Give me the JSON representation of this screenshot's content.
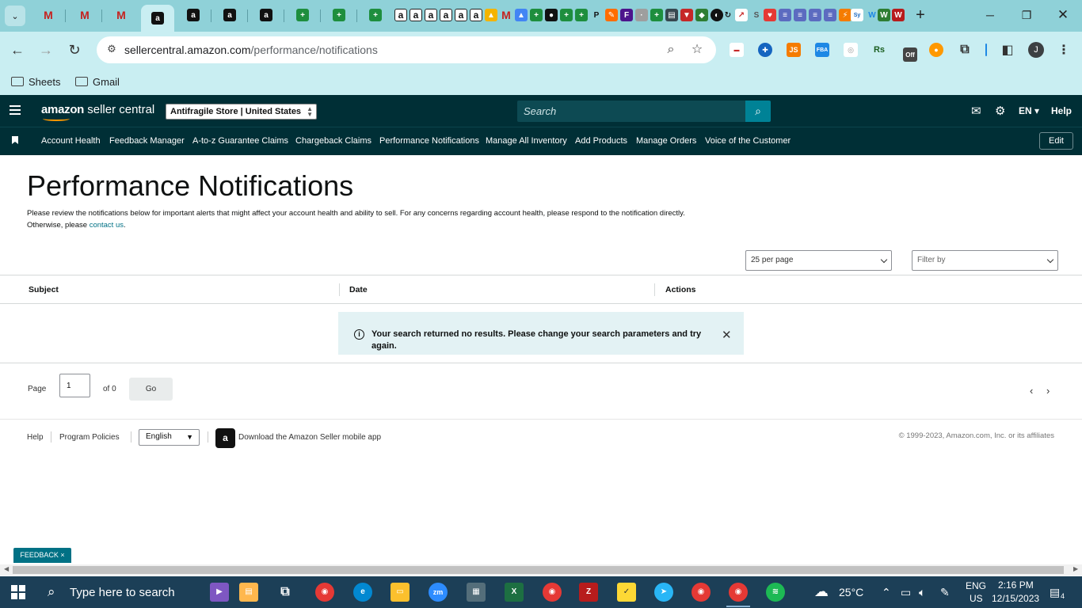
{
  "browser": {
    "url_domain": "sellercentral.amazon.com",
    "url_path": "/performance/notifications",
    "bookmarks": [
      "Sheets",
      "Gmail"
    ],
    "profile_initial": "J",
    "ext_labels": {
      "js": "JS",
      "fba": "FBA",
      "rs": "Rs",
      "off": "Off"
    }
  },
  "header": {
    "logo_bold": "amazon",
    "logo_rest": " seller central",
    "store": "Antifragile Store | United States",
    "search_placeholder": "Search",
    "language": "EN ▾",
    "help": "Help"
  },
  "nav": {
    "items": [
      "Account Health",
      "Feedback Manager",
      "A-to-z Guarantee Claims",
      "Chargeback Claims",
      "Performance Notifications",
      "Manage All Inventory",
      "Add Products",
      "Manage Orders",
      "Voice of the Customer"
    ],
    "edit": "Edit"
  },
  "main": {
    "title": "Performance Notifications",
    "desc_text": "Please review the notifications below for important alerts that might affect your account health and ability to sell. For any concerns regarding account health, please respond to the notification directly. Otherwise, please ",
    "desc_link": "contact us",
    "desc_end": ".",
    "per_page": "25 per page",
    "filter": "Filter by",
    "columns": [
      "Subject",
      "Date",
      "Actions"
    ],
    "no_results": "Your search returned no results. Please change your search parameters and try again."
  },
  "pager": {
    "page_label": "Page",
    "page_value": "1",
    "of_label": "of 0",
    "go": "Go"
  },
  "footer": {
    "help": "Help",
    "program_policies": "Program Policies",
    "language": "English",
    "app_link": "Download the Amazon Seller mobile app",
    "copyright": "© 1999-2023, Amazon.com, Inc. or its affiliates",
    "feedback": "FEEDBACK ×"
  },
  "taskbar": {
    "search_placeholder": "Type here to search",
    "weather": "25°C",
    "lang_line1": "ENG",
    "lang_line2": "US",
    "time": "2:16 PM",
    "date": "12/15/2023",
    "notification_count": "4"
  },
  "colors": {
    "header_bg": "#002f36",
    "accent": "#008296",
    "link": "#007185",
    "browser_chrome": "#8fd1d8"
  }
}
